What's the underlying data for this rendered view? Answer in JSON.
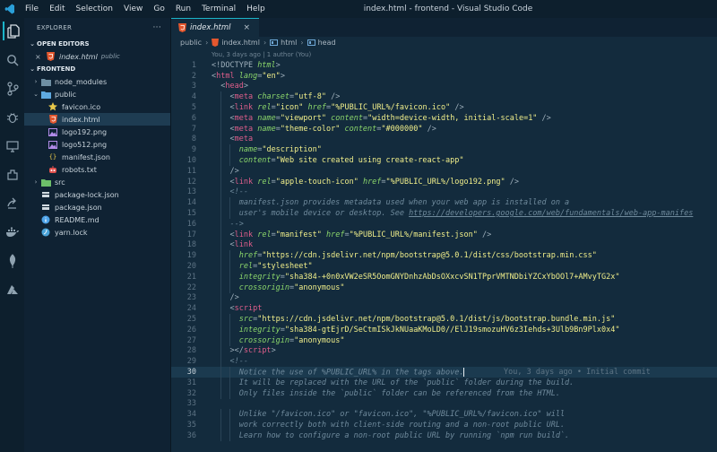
{
  "titlebar": {
    "menu": [
      "File",
      "Edit",
      "Selection",
      "View",
      "Go",
      "Run",
      "Terminal",
      "Help"
    ],
    "title": "index.html - frontend - Visual Studio Code"
  },
  "activity": {
    "items": [
      "files-icon",
      "search-icon",
      "source-control-icon",
      "debug-icon",
      "remote-explorer-icon",
      "extensions-icon",
      "live-share-icon",
      "docker-icon",
      "mongodb-icon",
      "azure-icon"
    ]
  },
  "sidebar": {
    "header": "EXPLORER",
    "more": "···",
    "open_editors": "OPEN EDITORS",
    "open_file": {
      "name": "index.html",
      "desc": "public"
    },
    "project": "FRONTEND",
    "tree": [
      {
        "name": "node_modules",
        "kind": "folder",
        "depth": 0,
        "arrow": "›",
        "color": "#6f8fa3"
      },
      {
        "name": "public",
        "kind": "folder",
        "depth": 0,
        "arrow": "⌄",
        "color": "#5ea9e0"
      },
      {
        "name": "favicon.ico",
        "kind": "star",
        "depth": 1,
        "color": "#e8c84a"
      },
      {
        "name": "index.html",
        "kind": "html",
        "depth": 1,
        "color": "#e4572e",
        "selected": true
      },
      {
        "name": "logo192.png",
        "kind": "image",
        "depth": 1,
        "color": "#b18be8"
      },
      {
        "name": "logo512.png",
        "kind": "image",
        "depth": 1,
        "color": "#b18be8"
      },
      {
        "name": "manifest.json",
        "kind": "json",
        "depth": 1,
        "color": "#e8c84a"
      },
      {
        "name": "robots.txt",
        "kind": "robot",
        "depth": 1,
        "color": "#e0504d"
      },
      {
        "name": "src",
        "kind": "folder",
        "depth": 0,
        "arrow": "›",
        "color": "#6dbf6a"
      },
      {
        "name": "package-lock.json",
        "kind": "npm",
        "depth": 0,
        "color": "#d1dae1"
      },
      {
        "name": "package.json",
        "kind": "npm",
        "depth": 0,
        "color": "#d1dae1"
      },
      {
        "name": "README.md",
        "kind": "info",
        "depth": 0,
        "color": "#4da3e8"
      },
      {
        "name": "yarn.lock",
        "kind": "yarn",
        "depth": 0,
        "color": "#4aa3d8"
      }
    ]
  },
  "editor": {
    "tab_label": "index.html",
    "breadcrumb": [
      "public",
      "index.html",
      "html",
      "head"
    ],
    "codelens": "You, 3 days ago | 1 author (You)",
    "blame": "You, 3 days ago • Initial commit",
    "current_line": 30,
    "lines": [
      {
        "n": 1,
        "ind": 0,
        "segs": [
          [
            "p",
            "<!DOCTYPE "
          ],
          [
            "a",
            "html"
          ],
          [
            "p",
            ">"
          ]
        ]
      },
      {
        "n": 2,
        "ind": 0,
        "segs": [
          [
            "p",
            "<"
          ],
          [
            "t",
            "html"
          ],
          [
            "a",
            " lang"
          ],
          [
            "p",
            "="
          ],
          [
            "s",
            "\"en\""
          ],
          [
            "p",
            ">"
          ]
        ]
      },
      {
        "n": 3,
        "ind": 1,
        "segs": [
          [
            "p",
            "<"
          ],
          [
            "t",
            "head"
          ],
          [
            "p",
            ">"
          ]
        ]
      },
      {
        "n": 4,
        "ind": 2,
        "segs": [
          [
            "p",
            "<"
          ],
          [
            "t",
            "meta"
          ],
          [
            "a",
            " charset"
          ],
          [
            "p",
            "="
          ],
          [
            "s",
            "\"utf-8\""
          ],
          [
            "p",
            " />"
          ]
        ]
      },
      {
        "n": 5,
        "ind": 2,
        "segs": [
          [
            "p",
            "<"
          ],
          [
            "t",
            "link"
          ],
          [
            "a",
            " rel"
          ],
          [
            "p",
            "="
          ],
          [
            "s",
            "\"icon\""
          ],
          [
            "a",
            " href"
          ],
          [
            "p",
            "="
          ],
          [
            "s",
            "\"%PUBLIC_URL%/favicon.ico\""
          ],
          [
            "p",
            " />"
          ]
        ]
      },
      {
        "n": 6,
        "ind": 2,
        "segs": [
          [
            "p",
            "<"
          ],
          [
            "t",
            "meta"
          ],
          [
            "a",
            " name"
          ],
          [
            "p",
            "="
          ],
          [
            "s",
            "\"viewport\""
          ],
          [
            "a",
            " content"
          ],
          [
            "p",
            "="
          ],
          [
            "s",
            "\"width=device-width, initial-scale=1\""
          ],
          [
            "p",
            " />"
          ]
        ]
      },
      {
        "n": 7,
        "ind": 2,
        "segs": [
          [
            "p",
            "<"
          ],
          [
            "t",
            "meta"
          ],
          [
            "a",
            " name"
          ],
          [
            "p",
            "="
          ],
          [
            "s",
            "\"theme-color\""
          ],
          [
            "a",
            " content"
          ],
          [
            "p",
            "="
          ],
          [
            "s",
            "\"#000000\""
          ],
          [
            "p",
            " />"
          ]
        ]
      },
      {
        "n": 8,
        "ind": 2,
        "segs": [
          [
            "p",
            "<"
          ],
          [
            "t",
            "meta"
          ]
        ]
      },
      {
        "n": 9,
        "ind": 3,
        "segs": [
          [
            "a",
            "name"
          ],
          [
            "p",
            "="
          ],
          [
            "s",
            "\"description\""
          ]
        ]
      },
      {
        "n": 10,
        "ind": 3,
        "segs": [
          [
            "a",
            "content"
          ],
          [
            "p",
            "="
          ],
          [
            "s",
            "\"Web site created using create-react-app\""
          ]
        ]
      },
      {
        "n": 11,
        "ind": 2,
        "segs": [
          [
            "p",
            "/>"
          ]
        ]
      },
      {
        "n": 12,
        "ind": 2,
        "segs": [
          [
            "p",
            "<"
          ],
          [
            "t",
            "link"
          ],
          [
            "a",
            " rel"
          ],
          [
            "p",
            "="
          ],
          [
            "s",
            "\"apple-touch-icon\""
          ],
          [
            "a",
            " href"
          ],
          [
            "p",
            "="
          ],
          [
            "s",
            "\"%PUBLIC_URL%/logo192.png\""
          ],
          [
            "p",
            " />"
          ]
        ]
      },
      {
        "n": 13,
        "ind": 2,
        "segs": [
          [
            "c",
            "<!--"
          ]
        ]
      },
      {
        "n": 14,
        "ind": 3,
        "segs": [
          [
            "c",
            "manifest.json provides metadata used when your web app is installed on a"
          ]
        ]
      },
      {
        "n": 15,
        "ind": 3,
        "segs": [
          [
            "c",
            "user's mobile device or desktop. See "
          ],
          [
            "cu",
            "https://developers.google.com/web/fundamentals/web-app-manifes"
          ]
        ]
      },
      {
        "n": 16,
        "ind": 2,
        "segs": [
          [
            "c",
            "-->"
          ]
        ]
      },
      {
        "n": 17,
        "ind": 2,
        "segs": [
          [
            "p",
            "<"
          ],
          [
            "t",
            "link"
          ],
          [
            "a",
            " rel"
          ],
          [
            "p",
            "="
          ],
          [
            "s",
            "\"manifest\""
          ],
          [
            "a",
            " href"
          ],
          [
            "p",
            "="
          ],
          [
            "s",
            "\"%PUBLIC_URL%/manifest.json\""
          ],
          [
            "p",
            " />"
          ]
        ]
      },
      {
        "n": 18,
        "ind": 2,
        "segs": [
          [
            "p",
            "<"
          ],
          [
            "t",
            "link"
          ]
        ]
      },
      {
        "n": 19,
        "ind": 3,
        "segs": [
          [
            "a",
            "href"
          ],
          [
            "p",
            "="
          ],
          [
            "s",
            "\"https://cdn.jsdelivr.net/npm/bootstrap@5.0.1/dist/css/bootstrap.min.css\""
          ]
        ]
      },
      {
        "n": 20,
        "ind": 3,
        "segs": [
          [
            "a",
            "rel"
          ],
          [
            "p",
            "="
          ],
          [
            "s",
            "\"stylesheet\""
          ]
        ]
      },
      {
        "n": 21,
        "ind": 3,
        "segs": [
          [
            "a",
            "integrity"
          ],
          [
            "p",
            "="
          ],
          [
            "s",
            "\"sha384-+0n0xVW2eSR5OomGNYDnhzAbDsOXxcvSN1TPprVMTNDbiYZCxYbOOl7+AMvyTG2x\""
          ]
        ]
      },
      {
        "n": 22,
        "ind": 3,
        "segs": [
          [
            "a",
            "crossorigin"
          ],
          [
            "p",
            "="
          ],
          [
            "s",
            "\"anonymous\""
          ]
        ]
      },
      {
        "n": 23,
        "ind": 2,
        "segs": [
          [
            "p",
            "/>"
          ]
        ]
      },
      {
        "n": 24,
        "ind": 2,
        "segs": [
          [
            "p",
            "<"
          ],
          [
            "t",
            "script"
          ]
        ]
      },
      {
        "n": 25,
        "ind": 3,
        "segs": [
          [
            "a",
            "src"
          ],
          [
            "p",
            "="
          ],
          [
            "s",
            "\"https://cdn.jsdelivr.net/npm/bootstrap@5.0.1/dist/js/bootstrap.bundle.min.js\""
          ]
        ]
      },
      {
        "n": 26,
        "ind": 3,
        "segs": [
          [
            "a",
            "integrity"
          ],
          [
            "p",
            "="
          ],
          [
            "s",
            "\"sha384-gtEjrD/SeCtmISkJkNUaaKMoLD0//ElJ19smozuHV6z3Iehds+3Ulb9Bn9Plx0x4\""
          ]
        ]
      },
      {
        "n": 27,
        "ind": 3,
        "segs": [
          [
            "a",
            "crossorigin"
          ],
          [
            "p",
            "="
          ],
          [
            "s",
            "\"anonymous\""
          ]
        ]
      },
      {
        "n": 28,
        "ind": 2,
        "segs": [
          [
            "p",
            "></"
          ],
          [
            "t",
            "script"
          ],
          [
            "p",
            ">"
          ]
        ]
      },
      {
        "n": 29,
        "ind": 2,
        "segs": [
          [
            "c",
            "<!--"
          ]
        ]
      },
      {
        "n": 30,
        "ind": 3,
        "segs": [
          [
            "c",
            "Notice the use of %PUBLIC_URL% in the tags above."
          ]
        ]
      },
      {
        "n": 31,
        "ind": 3,
        "segs": [
          [
            "c",
            "It will be replaced with the URL of the `public` folder during the build."
          ]
        ]
      },
      {
        "n": 32,
        "ind": 3,
        "segs": [
          [
            "c",
            "Only files inside the `public` folder can be referenced from the HTML."
          ]
        ]
      },
      {
        "n": 33,
        "ind": 0,
        "segs": []
      },
      {
        "n": 34,
        "ind": 3,
        "segs": [
          [
            "c",
            "Unlike \"/favicon.ico\" or \"favicon.ico\", \"%PUBLIC_URL%/favicon.ico\" will"
          ]
        ]
      },
      {
        "n": 35,
        "ind": 3,
        "segs": [
          [
            "c",
            "work correctly both with client-side routing and a non-root public URL."
          ]
        ]
      },
      {
        "n": 36,
        "ind": 3,
        "segs": [
          [
            "c",
            "Learn how to configure a non-root public URL by running `npm run build`."
          ]
        ]
      }
    ]
  }
}
